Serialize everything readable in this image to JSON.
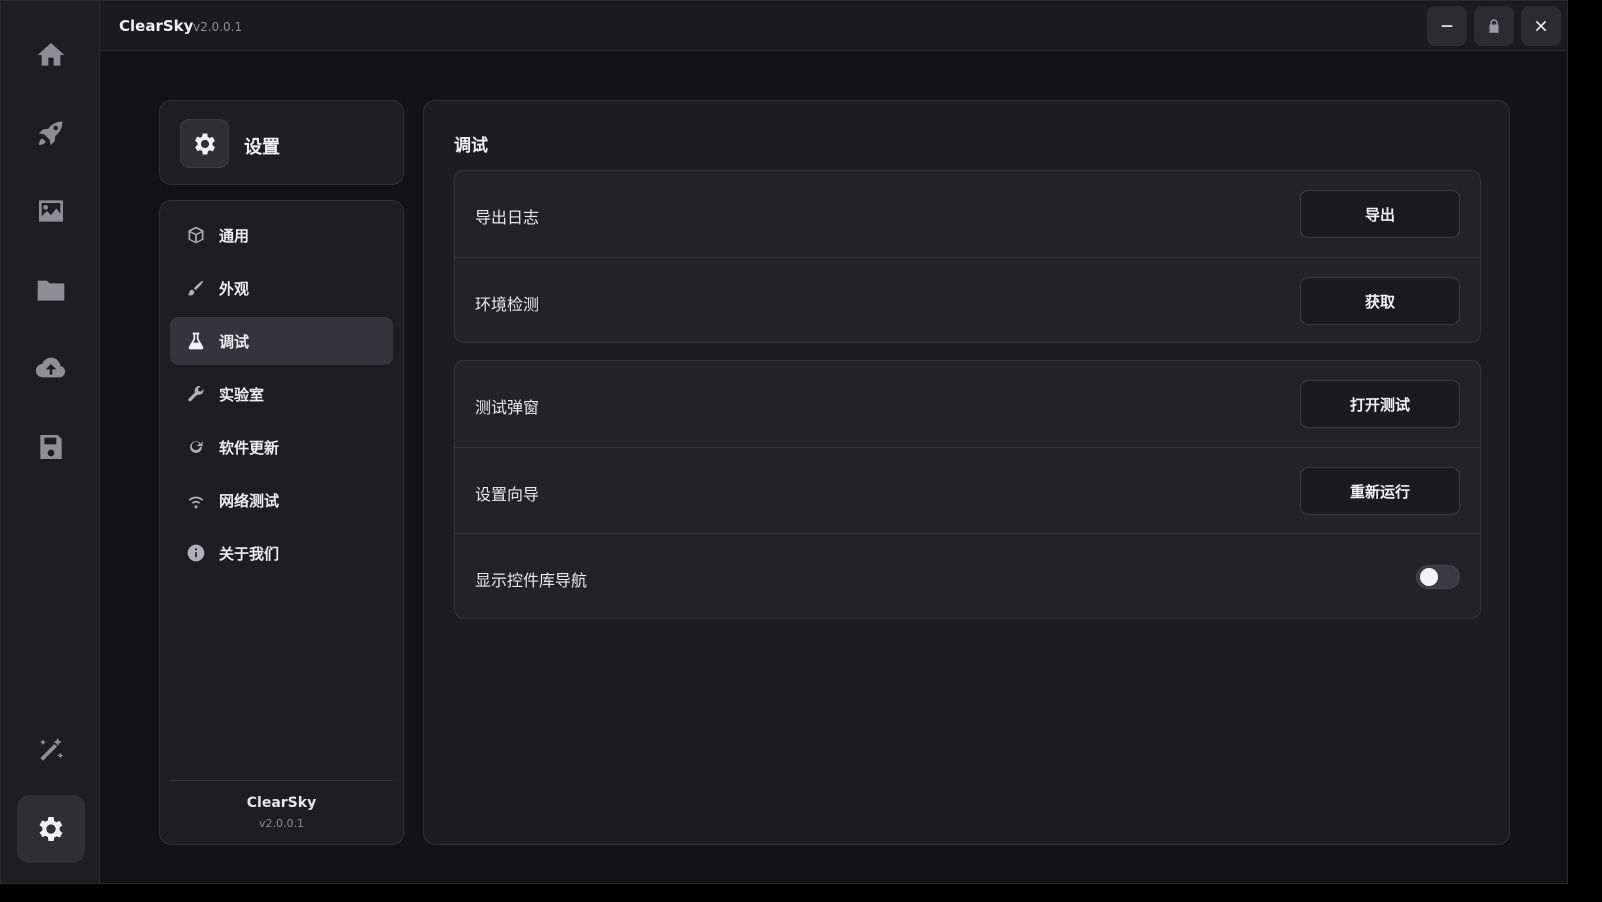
{
  "app": {
    "name": "ClearSky",
    "version": "v2.0.0.1"
  },
  "rail": {
    "items": [
      {
        "icon": "home-icon"
      },
      {
        "icon": "rocket-icon"
      },
      {
        "icon": "image-icon"
      },
      {
        "icon": "folder-icon"
      },
      {
        "icon": "cloud-upload-icon"
      },
      {
        "icon": "save-icon"
      },
      {
        "icon": "magic-wand-icon"
      },
      {
        "icon": "gear-icon",
        "active": true
      }
    ]
  },
  "window_controls": {
    "minimize": "minimize-icon",
    "lock": "lock-icon",
    "close": "close-icon"
  },
  "settings": {
    "title": "设置",
    "nav": [
      {
        "label": "通用",
        "icon": "cube-icon"
      },
      {
        "label": "外观",
        "icon": "brush-icon"
      },
      {
        "label": "调试",
        "icon": "flask-icon",
        "active": true
      },
      {
        "label": "实验室",
        "icon": "wrench-icon"
      },
      {
        "label": "软件更新",
        "icon": "refresh-icon"
      },
      {
        "label": "网络测试",
        "icon": "wifi-icon"
      },
      {
        "label": "关于我们",
        "icon": "info-icon"
      }
    ],
    "footer": {
      "name": "ClearSky",
      "version": "v2.0.0.1"
    }
  },
  "debug": {
    "title": "调试",
    "groups": [
      {
        "rows": [
          {
            "label": "导出日志",
            "button": "导出"
          },
          {
            "label": "环境检测",
            "button": "获取"
          }
        ]
      },
      {
        "rows": [
          {
            "label": "测试弹窗",
            "button": "打开测试"
          },
          {
            "label": "设置向导",
            "button": "重新运行"
          },
          {
            "label": "显示控件库导航",
            "toggle": false
          }
        ]
      }
    ]
  },
  "colors": {
    "background": "#131316",
    "panel": "#1d1d20",
    "accent_active": "#34343a"
  }
}
